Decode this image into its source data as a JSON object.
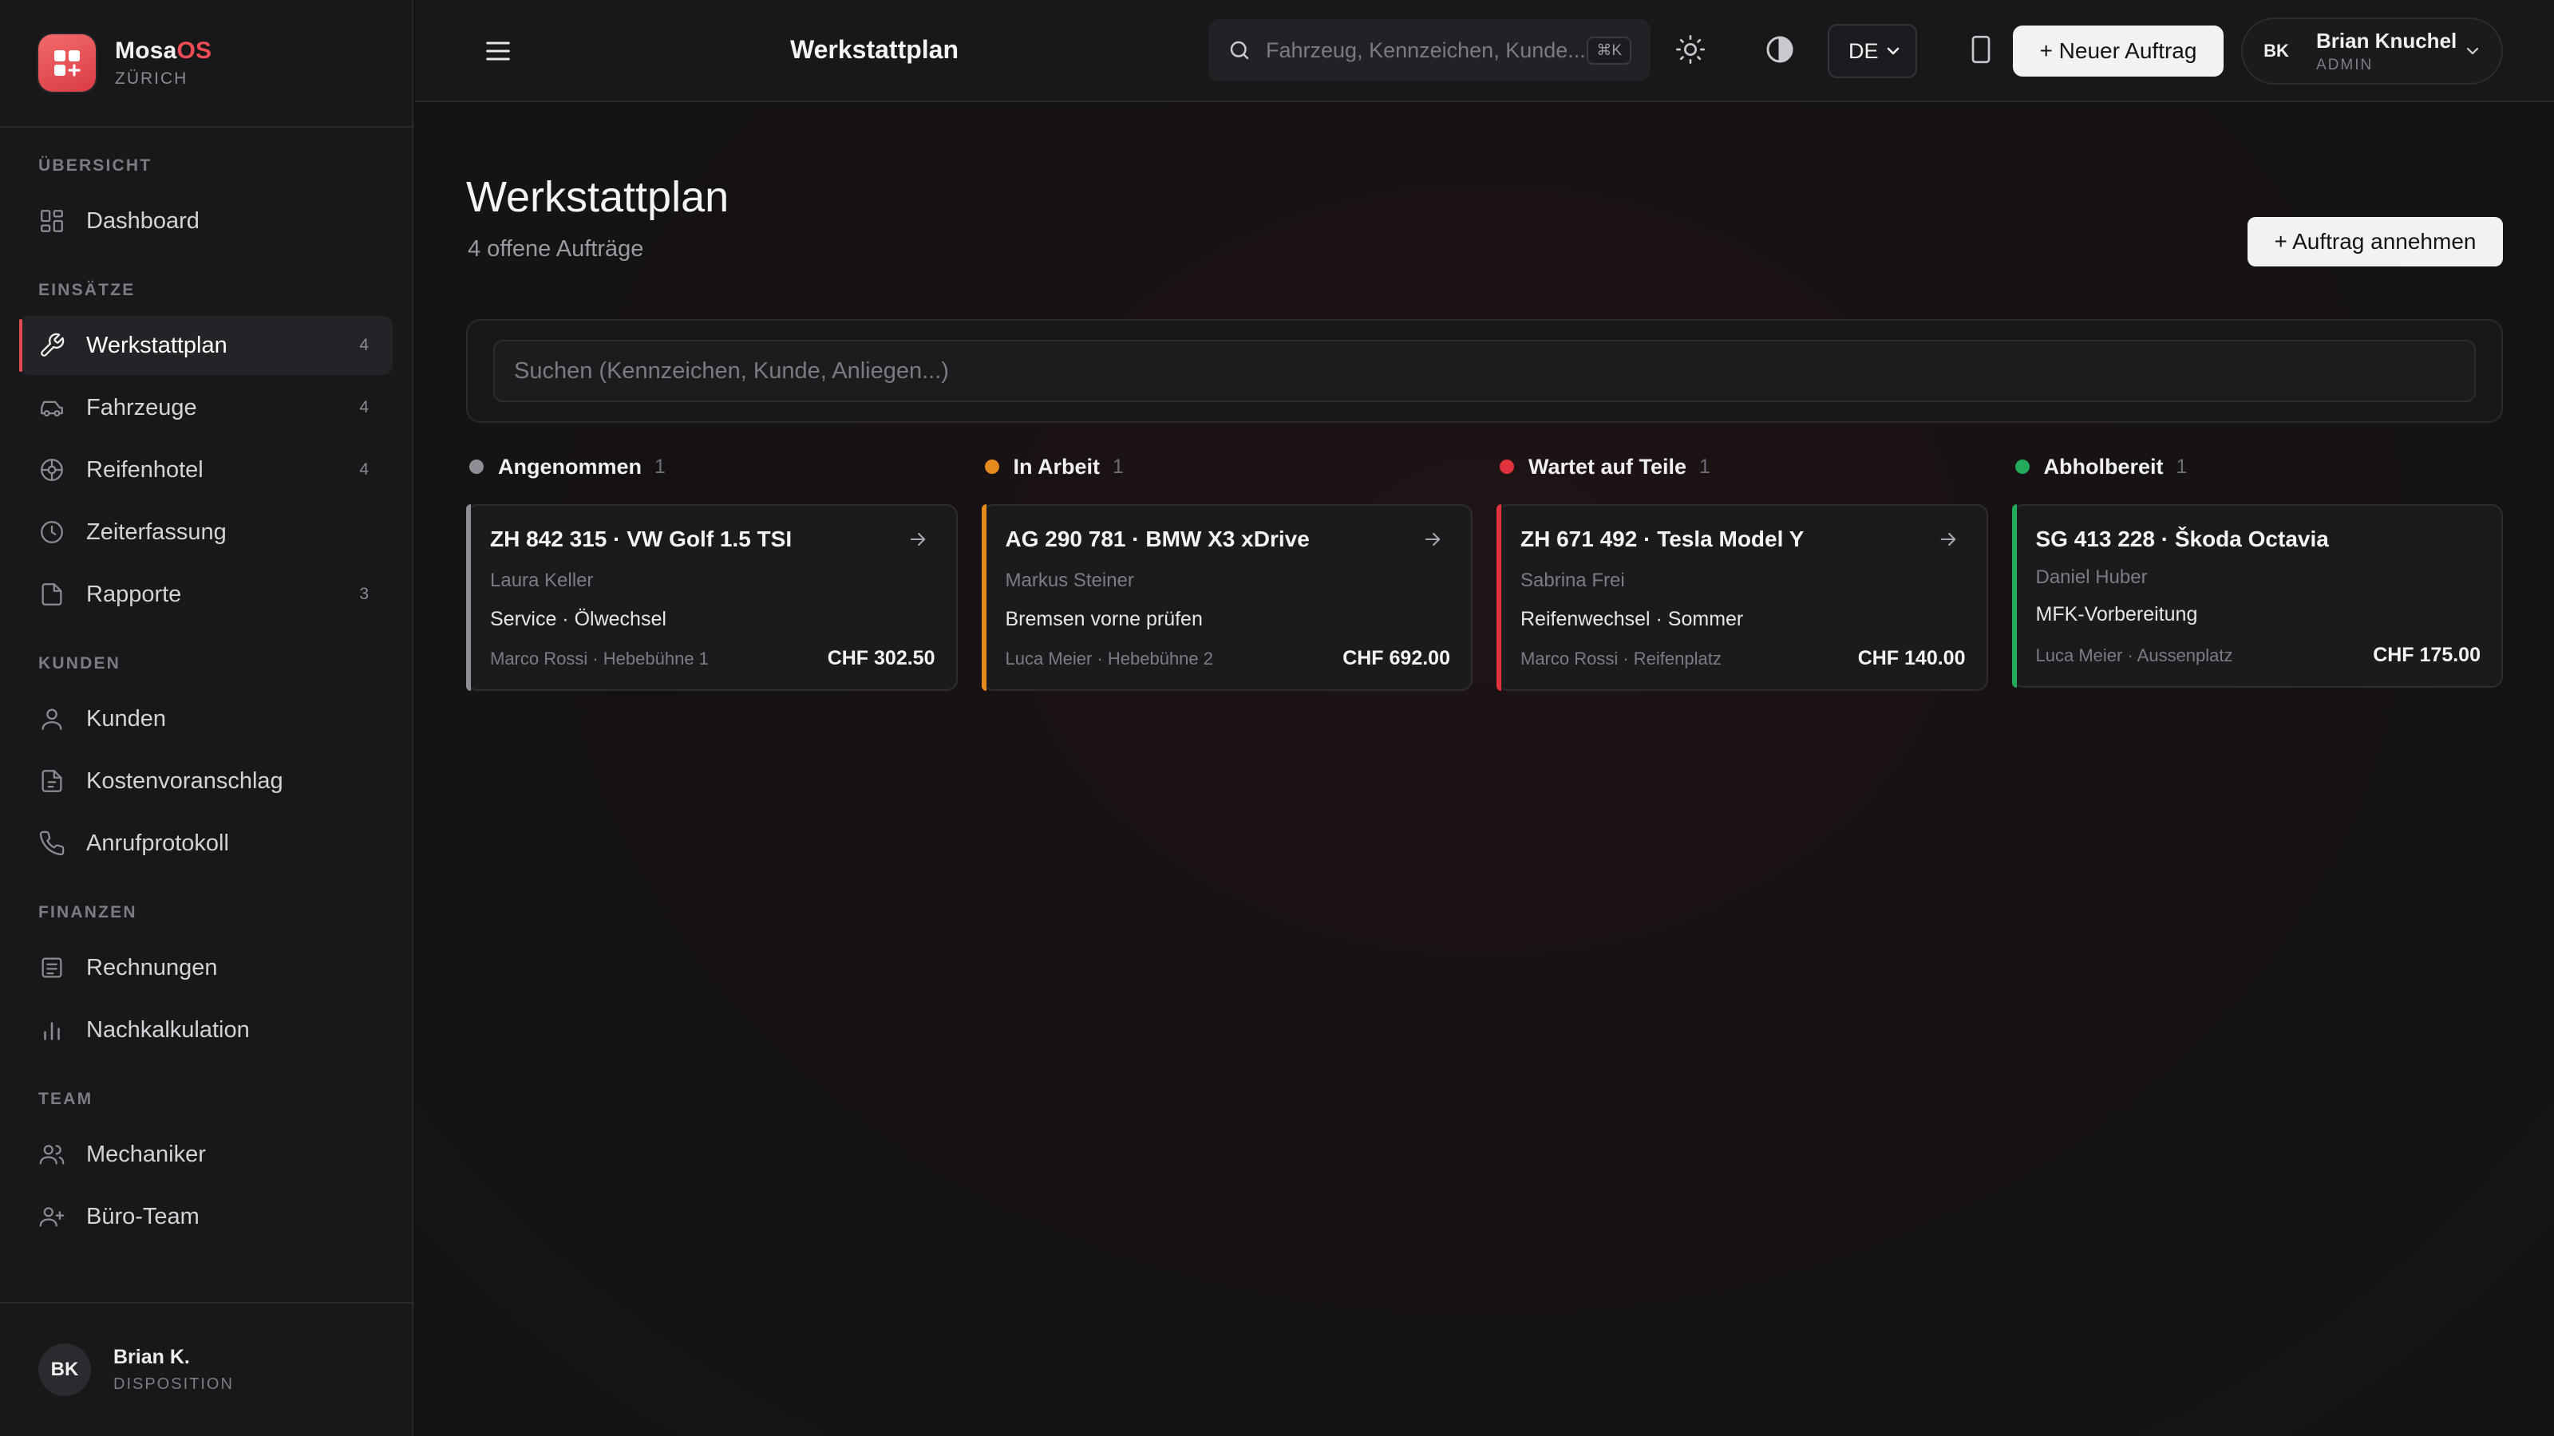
{
  "brand": {
    "name_main": "Mosa",
    "name_accent": "OS",
    "city": "ZÜRICH"
  },
  "sidebar": {
    "sections": [
      {
        "title": "ÜBERSICHT",
        "items": [
          {
            "label": "Dashboard",
            "icon": "grid-icon",
            "badge": ""
          }
        ]
      },
      {
        "title": "EINSÄTZE",
        "items": [
          {
            "label": "Werkstattplan",
            "icon": "wrench-icon",
            "badge": "4",
            "active": true
          },
          {
            "label": "Fahrzeuge",
            "icon": "car-icon",
            "badge": "4"
          },
          {
            "label": "Reifenhotel",
            "icon": "tire-icon",
            "badge": "4"
          },
          {
            "label": "Zeiterfassung",
            "icon": "clock-icon",
            "badge": ""
          },
          {
            "label": "Rapporte",
            "icon": "file-icon",
            "badge": "3"
          }
        ]
      },
      {
        "title": "KUNDEN",
        "items": [
          {
            "label": "Kunden",
            "icon": "user-icon",
            "badge": ""
          },
          {
            "label": "Kostenvoranschlag",
            "icon": "file-text-icon",
            "badge": ""
          },
          {
            "label": "Anrufprotokoll",
            "icon": "phone-icon",
            "badge": ""
          }
        ]
      },
      {
        "title": "FINANZEN",
        "items": [
          {
            "label": "Rechnungen",
            "icon": "receipt-icon",
            "badge": ""
          },
          {
            "label": "Nachkalkulation",
            "icon": "bar-chart-icon",
            "badge": ""
          }
        ]
      },
      {
        "title": "TEAM",
        "items": [
          {
            "label": "Mechaniker",
            "icon": "users-icon",
            "badge": ""
          },
          {
            "label": "Büro-Team",
            "icon": "user-plus-icon",
            "badge": ""
          }
        ]
      }
    ],
    "footer": {
      "initials": "BK",
      "name": "Brian K.",
      "role": "DISPOSITION"
    }
  },
  "header": {
    "title": "Werkstattplan",
    "search_placeholder": "Fahrzeug, Kennzeichen, Kunde...",
    "search_shortcut": "⌘K",
    "language": "DE",
    "new_order_label": "+ Neuer Auftrag",
    "user": {
      "initials": "BK",
      "name": "Brian Knuchel",
      "role": "ADMIN"
    }
  },
  "main": {
    "title": "Werkstattplan",
    "subtitle": "4 offene Aufträge",
    "accept_label": "+ Auftrag annehmen",
    "search_placeholder": "Suchen (Kennzeichen, Kunde, Anliegen...)"
  },
  "columns": [
    {
      "title": "Angenommen",
      "count": "1",
      "color": "#8e8e96",
      "card": {
        "title": "ZH 842 315 · VW Golf 1.5 TSI",
        "customer": "Laura Keller",
        "task": "Service · Ölwechsel",
        "meta": "Marco Rossi · Hebebühne 1",
        "price": "CHF 302.50",
        "arrow": true
      }
    },
    {
      "title": "In Arbeit",
      "count": "1",
      "color": "#e68a1f",
      "card": {
        "title": "AG 290 781 · BMW X3 xDrive",
        "customer": "Markus Steiner",
        "task": "Bremsen vorne prüfen",
        "meta": "Luca Meier · Hebebühne 2",
        "price": "CHF 692.00",
        "arrow": true
      }
    },
    {
      "title": "Wartet auf Teile",
      "count": "1",
      "color": "#e0333b",
      "card": {
        "title": "ZH 671 492 · Tesla Model Y",
        "customer": "Sabrina Frei",
        "task": "Reifenwechsel · Sommer",
        "meta": "Marco Rossi · Reifenplatz",
        "price": "CHF 140.00",
        "arrow": true
      }
    },
    {
      "title": "Abholbereit",
      "count": "1",
      "color": "#22a95a",
      "card": {
        "title": "SG 413 228 · Škoda Octavia",
        "customer": "Daniel Huber",
        "task": "MFK-Vorbereitung",
        "meta": "Luca Meier · Aussenplatz",
        "price": "CHF 175.00",
        "arrow": false
      }
    }
  ]
}
